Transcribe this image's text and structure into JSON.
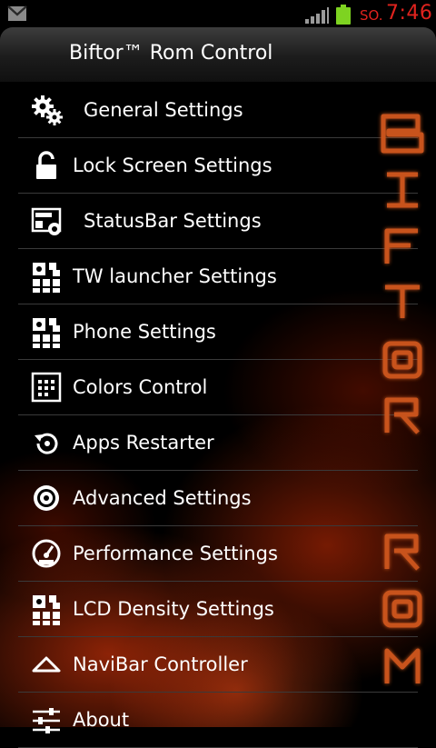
{
  "status_bar": {
    "carrier": "SO.",
    "time": "7:46",
    "icons": [
      "gmail-icon",
      "signal-icon",
      "battery-icon"
    ],
    "colors": {
      "time": "#e0231e",
      "battery": "#7ed321"
    }
  },
  "action_bar": {
    "title": "Biftor™ Rom Control"
  },
  "menu": {
    "items": [
      {
        "label": "General Settings",
        "icon": "gears-icon"
      },
      {
        "label": "Lock Screen Settings",
        "icon": "lock-icon"
      },
      {
        "label": "StatusBar Settings",
        "icon": "statusbar-icon"
      },
      {
        "label": "TW launcher Settings",
        "icon": "grid-gear-icon"
      },
      {
        "label": "Phone Settings",
        "icon": "grid-gear-icon"
      },
      {
        "label": "Colors Control",
        "icon": "color-grid-icon"
      },
      {
        "label": "Apps Restarter",
        "icon": "restart-icon"
      },
      {
        "label": "Advanced Settings",
        "icon": "gear-circle-icon"
      },
      {
        "label": "Performance Settings",
        "icon": "speedometer-icon"
      },
      {
        "label": "LCD Density Settings",
        "icon": "grid-gear-icon"
      },
      {
        "label": "NaviBar Controller",
        "icon": "navibar-icon"
      },
      {
        "label": "About",
        "icon": "sliders-icon"
      }
    ]
  },
  "logo": {
    "letters": [
      "B",
      "I",
      "F",
      "T",
      "O",
      "R",
      "R",
      "O",
      "M"
    ],
    "color": "#c8531a"
  }
}
